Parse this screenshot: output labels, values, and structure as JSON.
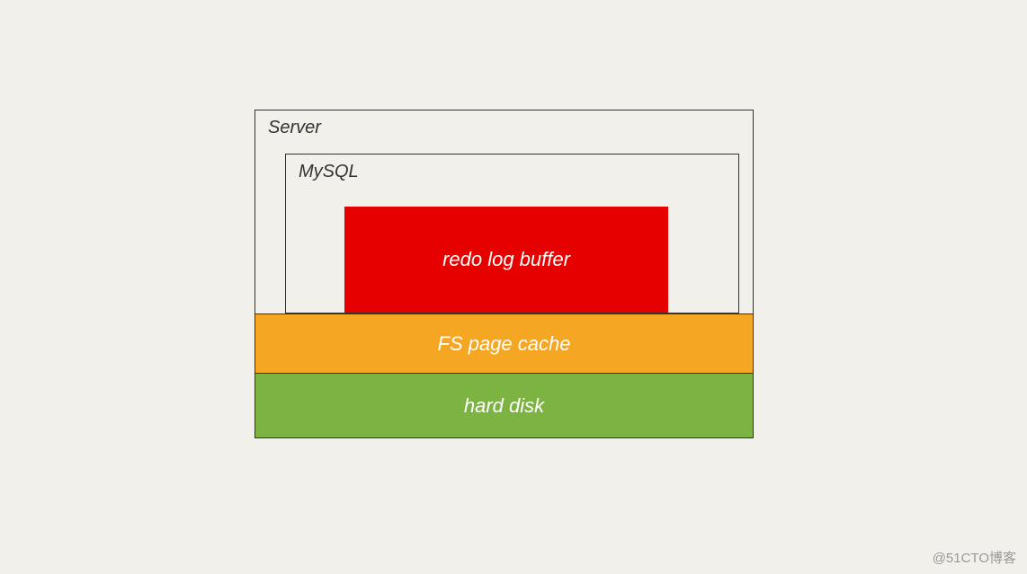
{
  "diagram": {
    "server": {
      "label": "Server",
      "mysql": {
        "label": "MySQL",
        "redo_log_buffer": {
          "label": "redo log buffer",
          "color": "#e60000"
        }
      }
    },
    "fs_page_cache": {
      "label": "FS page cache",
      "color": "#f5a623"
    },
    "hard_disk": {
      "label": "hard disk",
      "color": "#7cb342"
    }
  },
  "watermark": "@51CTO博客"
}
